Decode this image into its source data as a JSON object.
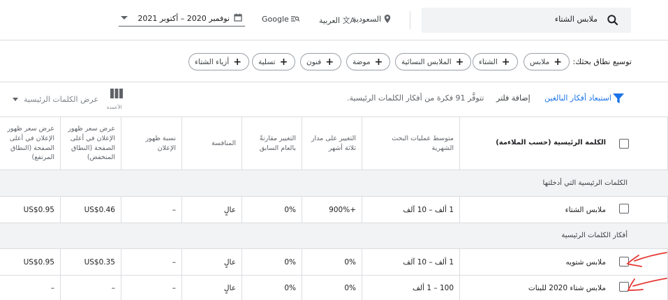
{
  "header": {
    "search_value": "ملابس الشتاء",
    "location": "السعودية",
    "language": "العربية",
    "network": "Google",
    "date_range": "نوفمبر 2020 – أكتوبر 2021"
  },
  "broaden": {
    "label": "توسيع نطاق بحثك:",
    "chips": [
      "ملابس",
      "الشتاء",
      "الملابس النسائية",
      "موضة",
      "فنون",
      "تسلية",
      "أزياء الشتاء"
    ]
  },
  "toolbar": {
    "exclude_adult": "استبعاد أفكار البالغين",
    "add_filter": "إضافة فلتر",
    "ideas_count": "تتوفَّر 91 فكرة من أفكار الكلمات الرئيسية.",
    "columns_label": "الأعمدة",
    "keyword_view": "عرض الكلمات الرئيسية"
  },
  "table": {
    "headers": {
      "keyword": "الكلمة الرئيسية (حسب الملاءمة)",
      "avg_searches": "متوسط عمليات البحث الشهرية",
      "three_month": "التغيير على مدار ثلاثة أشهر",
      "yoy": "التغيير مقارنةً بالعام السابق",
      "competition": "المنافسة",
      "impr_share": "نسبة ظهور الإعلان",
      "bid_low": "عرض سعر ظهور الإعلان في أعلى الصفحة (النطاق المنخفض)",
      "bid_high": "عرض سعر ظهور الإعلان في أعلى الصفحة (النطاق المرتفع)"
    },
    "group_provided": "الكلمات الرئيسية التي أدخلتها",
    "group_ideas": "أفكار الكلمات الرئيسية",
    "provided_rows": [
      {
        "keyword": "ملابس الشتاء",
        "avg": "1 ألف – 10 آلف",
        "three": "+900%",
        "yoy": "0%",
        "comp": "عالٍ",
        "impr": "–",
        "low": "US$0.46",
        "high": "US$0.95"
      }
    ],
    "idea_rows": [
      {
        "keyword": "ملابس شتويه",
        "avg": "1 ألف – 10 آلف",
        "three": "0%",
        "yoy": "0%",
        "comp": "عالٍ",
        "impr": "–",
        "low": "US$0.35",
        "high": "US$0.95"
      },
      {
        "keyword": "ملابس شتاء 2020 للبنات",
        "avg": "100 – 1 ألف",
        "three": "0%",
        "yoy": "0%",
        "comp": "عالٍ",
        "impr": "–",
        "low": "–",
        "high": "–"
      }
    ]
  },
  "colors": {
    "accent": "#1a73e8",
    "annotation": "#e53935",
    "group_bg": "#f1f3f4",
    "border": "#dadce0"
  }
}
